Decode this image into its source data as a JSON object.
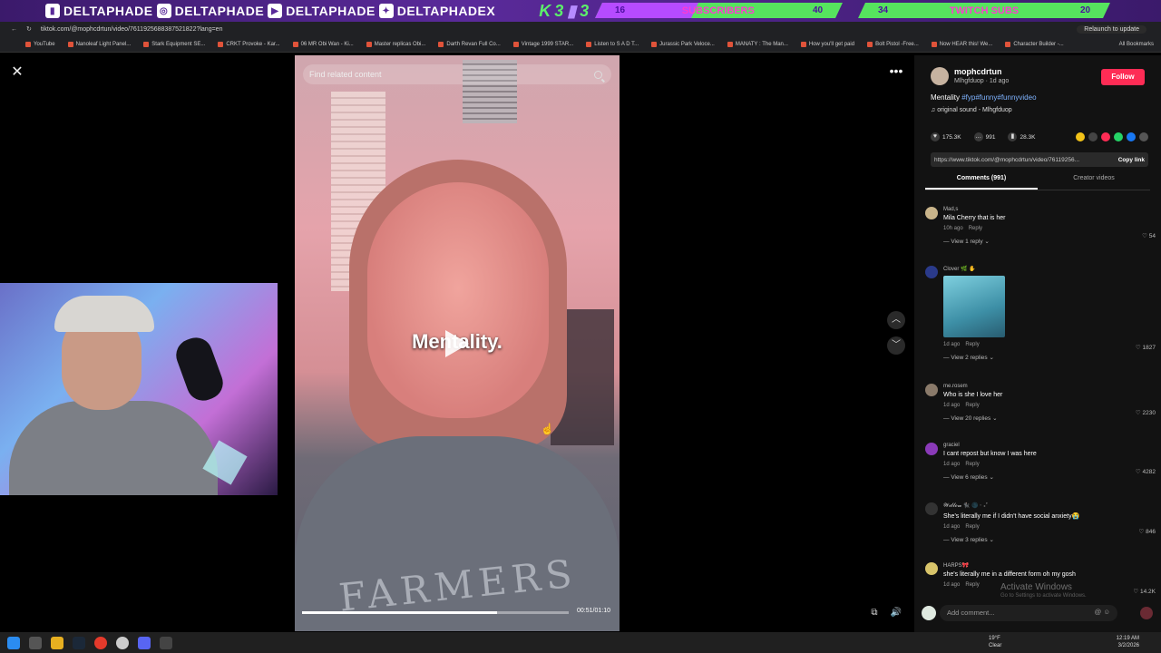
{
  "banner": {
    "socials": [
      "DELTAPHADE",
      "DELTAPHADE",
      "DELTAPHADE",
      "DELTAPHADEX"
    ],
    "logo_k": "K",
    "logo_3a": "3",
    "logo_3b": "3",
    "goals": [
      {
        "start": "16",
        "label": "SUBSCRIBERS",
        "end": "40",
        "progress": 0.4
      },
      {
        "start": "34",
        "label": "TWITCH SUBS",
        "end": "20",
        "progress": 0.0
      }
    ]
  },
  "browser": {
    "url": "tiktok.com/@mophcdrtun/video/7611925688387521822?lang=en",
    "relaunch": "Relaunch to update",
    "bookmarks": [
      "YouTube",
      "Nanoleaf Light Panel...",
      "Stark Equipment SE...",
      "CRKT Provoke - Kar...",
      "06 MR Obi Wan - Ki...",
      "Master replicas Obi...",
      "Darth Revan Full Co...",
      "Vintage 1999 STAR...",
      "Listen to S A D T...",
      "Jurassic Park Veloce...",
      "MANATY : The Man...",
      "How you'll get paid",
      "Bolt Pistol -Free...",
      "Now HEAR this! We...",
      "Character Builder -..."
    ],
    "all_bookmarks": "All Bookmarks"
  },
  "video": {
    "search_placeholder": "Find related content",
    "caption": "Mentality.",
    "shirt_text": "FARMERS",
    "time": "00:51/01:10",
    "progress": 0.73
  },
  "post": {
    "author": "mophcdrtun",
    "handle_time": "Mlhgfduop · 1d ago",
    "follow": "Follow",
    "desc_text": "Mentality ",
    "desc_tags": "#fyp#funny#funnyvideo",
    "sound": "original sound - Mlhgfduop",
    "likes": "175.3K",
    "comments": "991",
    "saves": "28.3K",
    "link": "https://www.tiktok.com/@mophcdrtun/video/76119256...",
    "copy_link": "Copy link",
    "tab_comments": "Comments (991)",
    "tab_creator": "Creator videos"
  },
  "comments": [
    {
      "user": "Mad,s",
      "text": "Mila Cherry that is her",
      "time": "10h ago",
      "reply": "Reply",
      "likes": "54",
      "replies": "View 1 reply",
      "color": "#c9b48a"
    },
    {
      "user": "Clover 🌿 ✋",
      "text": "",
      "time": "1d ago",
      "reply": "Reply",
      "likes": "1827",
      "replies": "View 2 replies",
      "color": "#2a3a8a",
      "image": true
    },
    {
      "user": "me.rosem",
      "text": "Who is she I love her",
      "time": "1d ago",
      "reply": "Reply",
      "likes": "2230",
      "replies": "View 20 replies",
      "color": "#8a7a6a"
    },
    {
      "user": "graciel",
      "text": "I cant repost but know I was here",
      "time": "1d ago",
      "reply": "Reply",
      "likes": "4282",
      "replies": "View 6 replies",
      "color": "#8a3ab8"
    },
    {
      "user": "𝓦𝓲𝓵𝓵𝓸𝔀 🐈‍⬛ 🌑 ‧ ₊˚",
      "text": "She's literally me if I didn't have social anxiety😭",
      "time": "1d ago",
      "reply": "Reply",
      "likes": "846",
      "replies": "View 3 replies",
      "color": "#333"
    },
    {
      "user": "HARPS🎀",
      "text": "she's literally me in a different form oh my gosh",
      "time": "1d ago",
      "reply": "Reply",
      "likes": "14.2K",
      "replies": "",
      "color": "#d8c46a"
    }
  ],
  "windows_watermark": "Activate Windows",
  "windows_watermark_sub": "Go to Settings to activate Windows.",
  "add_comment": "Add comment...",
  "taskbar": {
    "temp": "19°F",
    "weather": "Clear",
    "time": "12:19 AM",
    "date": "3/2/2026"
  }
}
